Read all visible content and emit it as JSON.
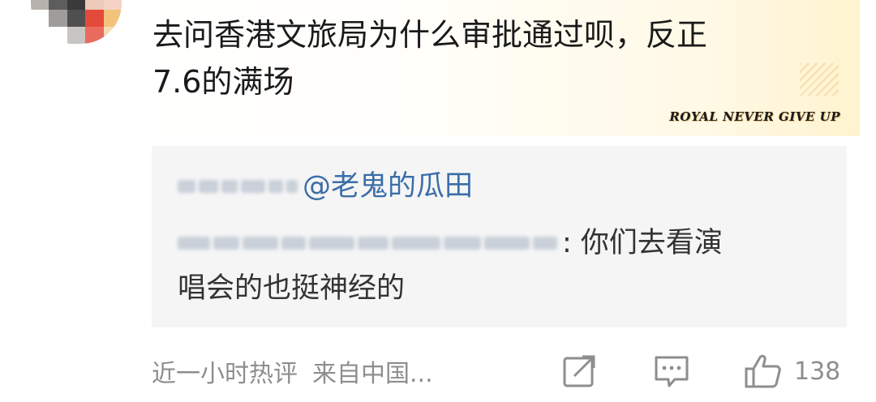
{
  "comment": {
    "text_line1": "去问香港文旅局为什么审批通过呗，反正",
    "text_line2": "7.6的满场"
  },
  "badge": {
    "text": "ROYAL NEVER GIVE UP"
  },
  "quote": {
    "mention": "@老鬼的瓜田",
    "line2_suffix": ": 你们去看演",
    "line3": "唱会的也挺神经的"
  },
  "footer": {
    "time": "近一小时热评",
    "location": "来自中国...",
    "like_count": "138"
  },
  "icons": {
    "share": "share-icon",
    "comment": "comment-icon",
    "like": "thumbs-up-icon"
  },
  "colors": {
    "mention": "#3b6ea8",
    "meta": "#8e8e8e",
    "quote_bg": "#f5f5f5"
  }
}
